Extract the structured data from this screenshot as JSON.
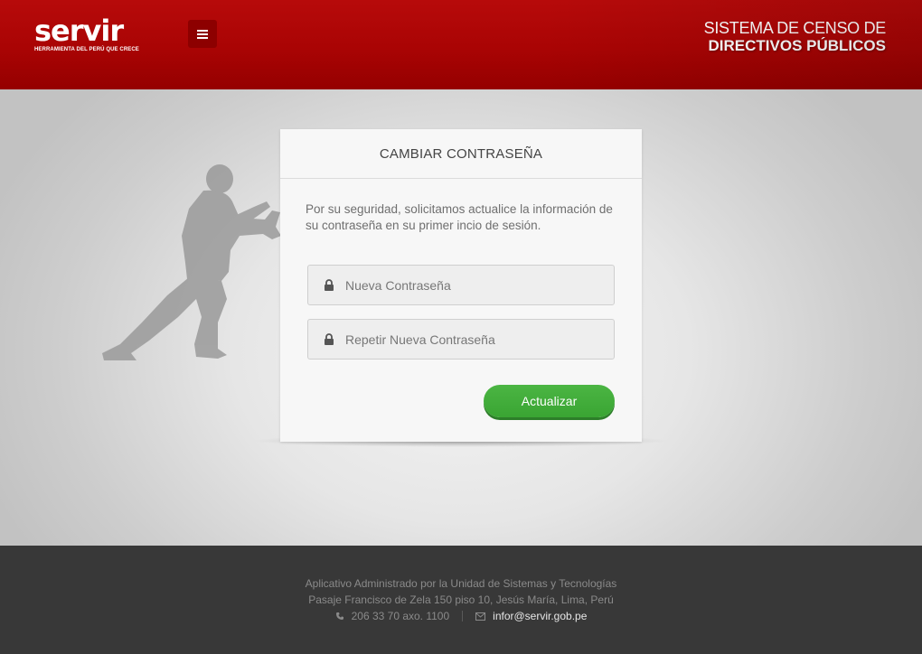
{
  "header": {
    "logo_text": "servir",
    "logo_tagline": "HERRAMIENTA DEL PERÚ QUE CRECE",
    "system_title_line1": "SISTEMA DE CENSO  DE",
    "system_title_line2": "DIRECTIVOS PÚBLICOS",
    "menu_icon": "hamburger-icon"
  },
  "card": {
    "title": "CAMBIAR CONTRASEÑA",
    "description": "Por su seguridad, solicitamos actualice la información de su contraseña en su primer incio de sesión.",
    "new_password": {
      "placeholder": "Nueva Contraseña",
      "value": ""
    },
    "repeat_password": {
      "placeholder": "Repetir Nueva Contraseña",
      "value": ""
    },
    "submit_label": "Actualizar"
  },
  "footer": {
    "line1": "Aplicativo Administrado por la Unidad de Sistemas y Tecnologías",
    "line2": "Pasaje Francisco de Zela 150 piso 10, Jesús María, Lima, Perú",
    "phone": "206 33 70 axo. 1100",
    "email": "infor@servir.gob.pe"
  },
  "colors": {
    "header_red": "#a90404",
    "button_green": "#3aa533",
    "footer_bg": "#383838"
  }
}
